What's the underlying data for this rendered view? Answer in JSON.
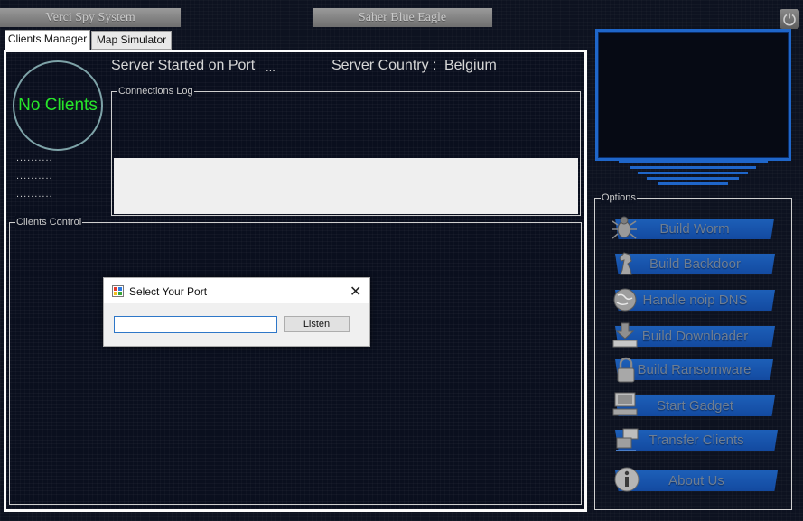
{
  "header": {
    "left_title": "Verci Spy System",
    "center_title": "Saher Blue Eagle"
  },
  "tabs": [
    {
      "label": "Clients Manager",
      "active": true
    },
    {
      "label": "Map Simulator",
      "active": false
    }
  ],
  "clients": {
    "status": "No Clients",
    "placeholder_lines": [
      "..........",
      "..........",
      ".........."
    ]
  },
  "server": {
    "port_label": "Server Started on Port",
    "port_value": "...",
    "country_label": "Server  Country :",
    "country_value": "Belgium"
  },
  "connections_log": {
    "label": "Connections Log"
  },
  "clients_control": {
    "label": "Clients Control"
  },
  "dialog": {
    "title": "Select Your Port",
    "close": "✕",
    "input_value": "",
    "listen_label": "Listen"
  },
  "options": {
    "label": "Options",
    "items": [
      {
        "label": "Build Worm",
        "icon": "bug-icon"
      },
      {
        "label": "Build Backdoor",
        "icon": "chess-knight-icon"
      },
      {
        "label": "Handle noip DNS",
        "icon": "globe-icon"
      },
      {
        "label": "Build Downloader",
        "icon": "download-icon"
      },
      {
        "label": "Build Ransomware",
        "icon": "padlock-icon"
      },
      {
        "label": "Start Gadget",
        "icon": "computer-icon"
      },
      {
        "label": "Transfer Clients",
        "icon": "network-transfer-icon"
      },
      {
        "label": "About Us",
        "icon": "info-icon"
      }
    ]
  },
  "colors": {
    "background": "#0d1220",
    "accent_blue": "#1f66c9",
    "clients_text": "#27e52a",
    "option_text": "#6e7e92"
  }
}
